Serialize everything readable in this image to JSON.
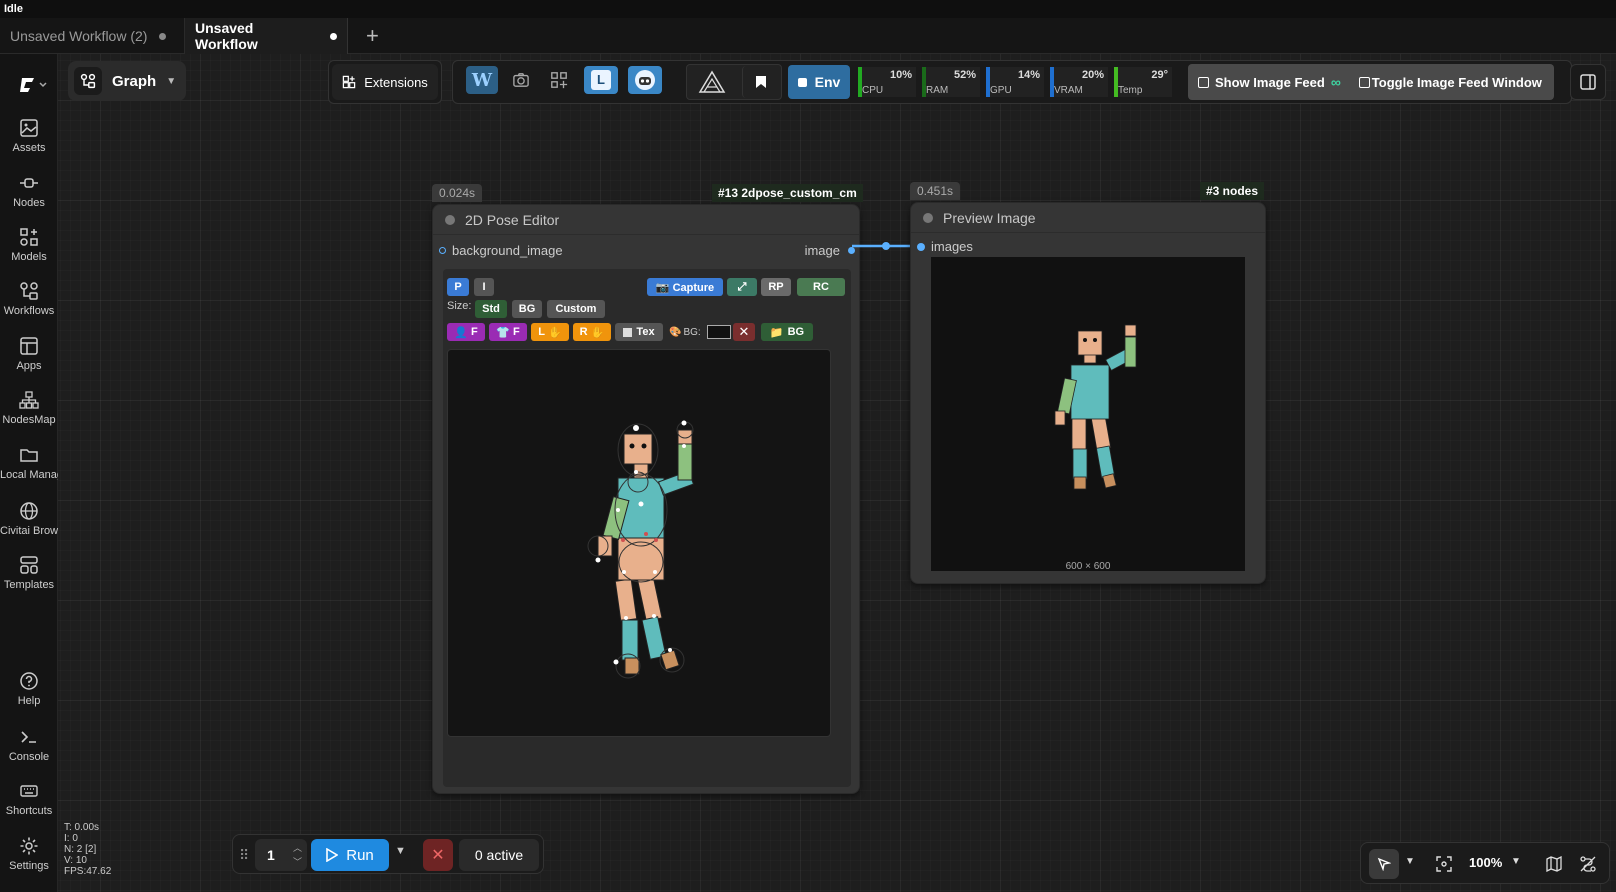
{
  "window": {
    "status": "Idle"
  },
  "tabs": [
    {
      "label": "Unsaved Workflow (2)",
      "active": false
    },
    {
      "label": "Unsaved Workflow",
      "active": true
    }
  ],
  "sidebar": {
    "items": [
      {
        "label": "Assets",
        "icon": "image-icon"
      },
      {
        "label": "Nodes",
        "icon": "plug-icon"
      },
      {
        "label": "Models",
        "icon": "shapes-icon"
      },
      {
        "label": "Workflows",
        "icon": "workflow-icon"
      },
      {
        "label": "Apps",
        "icon": "layout-icon"
      },
      {
        "label": "NodesMap",
        "icon": "sitemap-icon"
      },
      {
        "label": "Local Manager",
        "icon": "folder-icon"
      },
      {
        "label": "Civitai Browser",
        "icon": "globe-icon"
      },
      {
        "label": "Templates",
        "icon": "templates-icon"
      }
    ],
    "bottom": [
      {
        "label": "Help",
        "icon": "help-icon"
      },
      {
        "label": "Console",
        "icon": "terminal-icon"
      },
      {
        "label": "Shortcuts",
        "icon": "keyboard-icon"
      },
      {
        "label": "Settings",
        "icon": "gear-icon"
      }
    ]
  },
  "toolbar": {
    "graph_label": "Graph",
    "extensions_label": "Extensions",
    "env_label": "Env",
    "monitors": [
      {
        "label": "CPU",
        "value": "10%",
        "color": "#22aa22"
      },
      {
        "label": "RAM",
        "value": "52%",
        "color": "#1a6b1a"
      },
      {
        "label": "GPU",
        "value": "14%",
        "color": "#1f6fd0"
      },
      {
        "label": "VRAM",
        "value": "20%",
        "color": "#1f6fd0"
      },
      {
        "label": "Temp",
        "value": "29°",
        "color": "#44bb22"
      }
    ],
    "show_feed_label": "Show Image Feed",
    "toggle_feed_label": "Toggle Image Feed Window"
  },
  "pose_node": {
    "time": "0.024s",
    "id_label": "#13 2dpose_custom_cm",
    "title": "2D Pose Editor",
    "input_label": "background_image",
    "output_label": "image",
    "buttons": {
      "p": "P",
      "i": "I",
      "capture": "📷 Capture",
      "expand": "⤢",
      "rp": "RP",
      "rc": "RC",
      "size_label": "Size:",
      "std": "Std",
      "bg": "BG",
      "custom": "Custom",
      "face_f": "F",
      "shirt_f": "F",
      "l": "L",
      "r": "R",
      "tex": "Tex",
      "bg_color_label": "BG:",
      "clear": "✕",
      "bg_folder": "BG"
    }
  },
  "preview_node": {
    "time": "0.451s",
    "id_label": "#3 nodes",
    "title": "Preview Image",
    "input_label": "images",
    "size_text": "600 × 600"
  },
  "runbar": {
    "count": "1",
    "run_label": "Run",
    "active_label": "0 active"
  },
  "stats": {
    "t": "T: 0.00s",
    "i": "I: 0",
    "n": "N: 2 [2]",
    "v": "V: 10",
    "fps": "FPS:47.62"
  },
  "zoom": {
    "level": "100%"
  }
}
